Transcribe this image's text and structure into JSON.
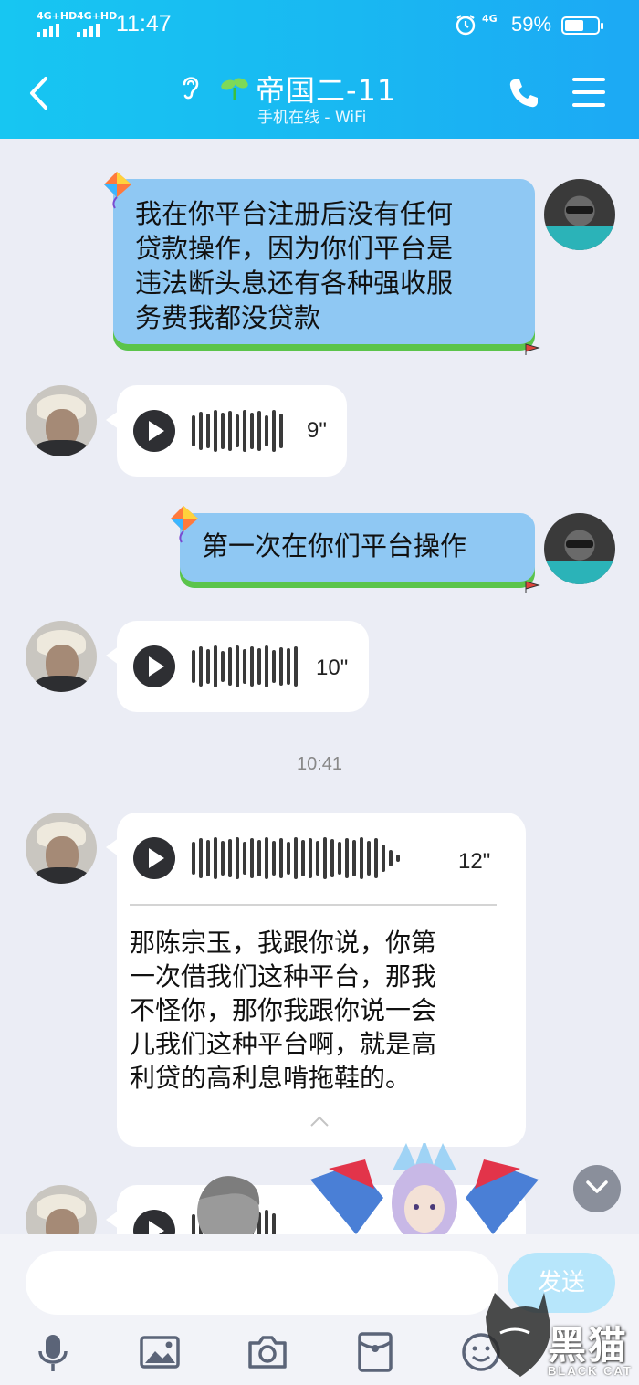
{
  "status_bar": {
    "signal1_label": "4G+HD",
    "signal2_label": "4G+HD",
    "time": "11:47",
    "net_label": "4G",
    "battery_percent_text": "59%",
    "battery_level": 0.59
  },
  "header": {
    "title": "帝国二-11",
    "subtitle": "手机在线 - WiFi"
  },
  "messages": {
    "m1_text": "我在你平台注册后没有任何\n贷款操作，因为你们平台是\n违法断头息还有各种强收服\n务费我都没贷款",
    "m2_duration": "9\"",
    "m3_text": "第一次在你们平台操作",
    "m4_duration": "10\"",
    "time_divider": "10:41",
    "m5_duration": "12\"",
    "m5_transcript": "那陈宗玉，我跟你说，你第\n一次借我们这种平台，那我\n不怪你，那你我跟你说一会\n儿我们这种平台啊，就是高\n利贷的高利息啃拖鞋的。"
  },
  "input_bar": {
    "send_label": "发送",
    "input_value": ""
  },
  "watermark": {
    "text": "黑猫",
    "sub": "BLACK CAT"
  },
  "colors": {
    "header_gradient_start": "#17c6f2",
    "header_gradient_end": "#1ca9f4",
    "my_bubble": "#8fc8f3",
    "incoming_bubble": "#ffffff",
    "background": "#ebedf5",
    "send_button": "#b7e6fb"
  },
  "icons": [
    "back-arrow-icon",
    "ear-icon",
    "sprout-icon",
    "phone-icon",
    "menu-icon",
    "play-icon",
    "chevron-up-icon",
    "chevron-down-icon",
    "microphone-icon",
    "image-icon",
    "camera-icon",
    "red-packet-icon",
    "emoji-icon"
  ]
}
